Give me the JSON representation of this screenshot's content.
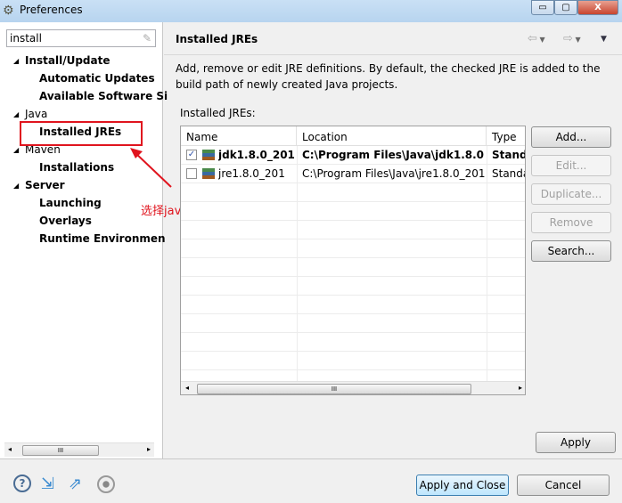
{
  "window": {
    "title": "Preferences",
    "minimize": "▭",
    "maximize": "▢",
    "close": "X"
  },
  "filter": {
    "value": "install"
  },
  "tree": [
    {
      "label": "Install/Update",
      "level": 0,
      "bold": true,
      "expanded": true
    },
    {
      "label": "Automatic Updates",
      "level": 1,
      "bold": true
    },
    {
      "label": "Available Software Si",
      "level": 1,
      "bold": true
    },
    {
      "label": "Java",
      "level": 0,
      "bold": false,
      "expanded": true
    },
    {
      "label": "Installed JREs",
      "level": 1,
      "bold": true,
      "selected": true
    },
    {
      "label": "Maven",
      "level": 0,
      "bold": false,
      "expanded": true
    },
    {
      "label": "Installations",
      "level": 1,
      "bold": true
    },
    {
      "label": "Server",
      "level": 0,
      "bold": true,
      "expanded": true
    },
    {
      "label": "Launching",
      "level": 1,
      "bold": true
    },
    {
      "label": "Overlays",
      "level": 1,
      "bold": true
    },
    {
      "label": "Runtime Environmen",
      "level": 1,
      "bold": true
    }
  ],
  "annotation": {
    "text": "选择java 中的install jres",
    "color": "#e0141e"
  },
  "page": {
    "title": "Installed JREs",
    "description": "Add, remove or edit JRE definitions. By default, the checked JRE is added to the build path of newly created Java projects.",
    "table_label": "Installed JREs:",
    "columns": [
      "Name",
      "Location",
      "Type"
    ],
    "rows": [
      {
        "checked": true,
        "bold": true,
        "name": "jdk1.8.0_201...",
        "location": "C:\\Program Files\\Java\\jdk1.8.0...",
        "type": "Stand"
      },
      {
        "checked": false,
        "bold": false,
        "name": "jre1.8.0_201",
        "location": "C:\\Program Files\\Java\\jre1.8.0_201",
        "type": "Standa"
      }
    ],
    "buttons": {
      "add": "Add...",
      "edit": "Edit...",
      "duplicate": "Duplicate...",
      "remove": "Remove",
      "search": "Search..."
    },
    "apply": "Apply"
  },
  "footer": {
    "apply_close": "Apply and Close",
    "cancel": "Cancel"
  }
}
